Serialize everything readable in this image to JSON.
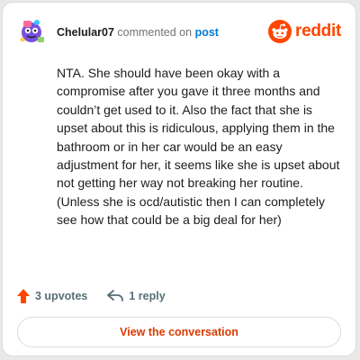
{
  "comment": {
    "username": "Chelular07",
    "action": "commented on",
    "post_link": "post",
    "text": "NTA. She should have been okay with a compromise after you gave it three months and couldn’t get used to it. Also the fact that she is upset about this is ridiculous, applying them in the bathroom or in her car would be an easy adjustment for her, it seems like she is upset about not getting her way not breaking her routine. (Unless she is ocd/autistic then I can completely see how that could be a big deal for her)"
  },
  "brand": {
    "name": "reddit",
    "color": "#ff4500"
  },
  "footer": {
    "upvotes": "3 upvotes",
    "replies": "1 reply"
  },
  "cta": {
    "label": "View the conversation"
  },
  "icons": [
    "avatar",
    "reddit-logo-icon",
    "upvote-icon",
    "reply-icon"
  ]
}
